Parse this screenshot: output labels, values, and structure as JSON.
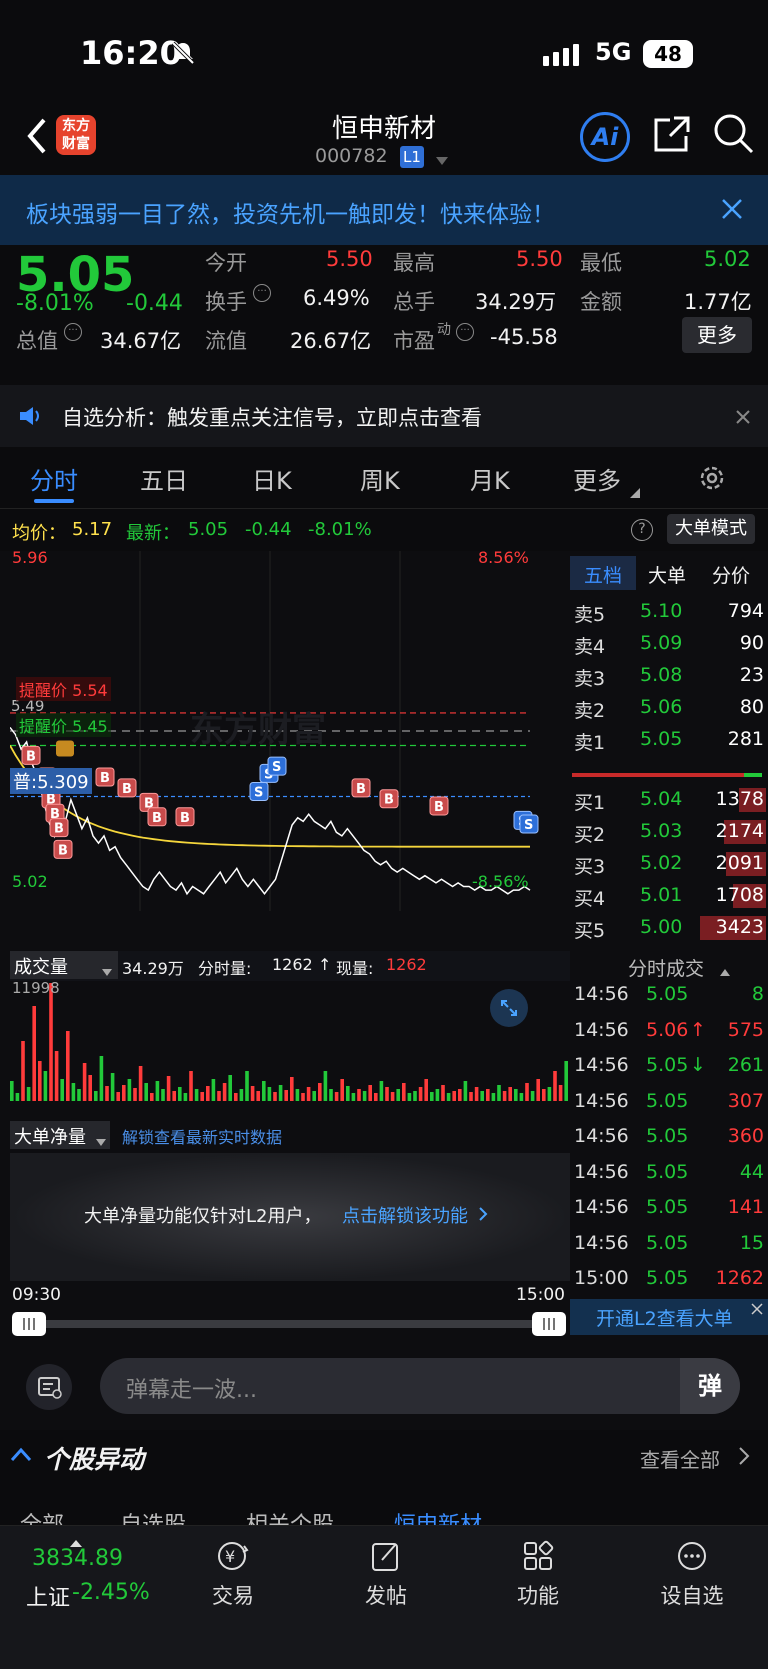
{
  "status_bar": {
    "time": "16:20",
    "network": "5G",
    "battery": "48"
  },
  "header": {
    "stock_name": "恒申新材",
    "stock_code": "000782",
    "level_badge": "L1",
    "logo_text": "东方财富",
    "ai_label": "Ai"
  },
  "banner": {
    "text": "板块强弱一目了然，投资先机一触即发！快来体验！"
  },
  "quote": {
    "price": "5.05",
    "change_pct": "-8.01%",
    "change": "-0.44",
    "open_label": "今开",
    "open": "5.50",
    "high_label": "最高",
    "high": "5.50",
    "low_label": "最低",
    "low": "5.02",
    "turnover_label": "换手",
    "turnover": "6.49%",
    "volume_label": "总手",
    "volume": "34.29万",
    "amount_label": "金额",
    "amount": "1.77亿",
    "mktcap_label": "总值",
    "mktcap": "34.67亿",
    "float_label": "流值",
    "float_cap": "26.67亿",
    "pe_label": "市盈",
    "pe_sup": "动",
    "pe": "-45.58",
    "more_label": "更多"
  },
  "notice": {
    "text": "自选分析：触发重点关注信号，立即点击查看"
  },
  "tabs": [
    "分时",
    "五日",
    "日K",
    "周K",
    "月K",
    "更多"
  ],
  "avg_line": {
    "avg_label": "均价：",
    "avg": "5.17",
    "latest_label": "最新：",
    "latest": "5.05",
    "chg": "-0.44",
    "pct": "-8.01%",
    "mode_label": "大单模式"
  },
  "chart": {
    "price_max": "5.96",
    "pct_max": "8.56%",
    "price_min": "5.02",
    "pct_min": "-8.56%",
    "prev_close": "5.49",
    "alert_high_label": "提醒价 5.54",
    "alert_low_label": "提醒价 5.45",
    "marker_label": "普:5.309",
    "watermark": "东方财富",
    "colors": {
      "price": "#ffffff",
      "avg": "#f5d63c",
      "up": "#ff3b3b",
      "down": "#22c93a",
      "alert_high": "#ff3b3b",
      "alert_low": "#22c93a",
      "marker": "#3a8dff"
    }
  },
  "orderbook": {
    "tabs": [
      "五档",
      "大单",
      "分价"
    ],
    "asks": [
      {
        "label": "卖5",
        "price": "5.10",
        "vol": "794"
      },
      {
        "label": "卖4",
        "price": "5.09",
        "vol": "90"
      },
      {
        "label": "卖3",
        "price": "5.08",
        "vol": "23"
      },
      {
        "label": "卖2",
        "price": "5.06",
        "vol": "80"
      },
      {
        "label": "卖1",
        "price": "5.05",
        "vol": "281"
      }
    ],
    "bids": [
      {
        "label": "买1",
        "price": "5.04",
        "vol": "1378"
      },
      {
        "label": "买2",
        "price": "5.03",
        "vol": "2174"
      },
      {
        "label": "买3",
        "price": "5.02",
        "vol": "2091"
      },
      {
        "label": "买4",
        "price": "5.01",
        "vol": "1708"
      },
      {
        "label": "买5",
        "price": "5.00",
        "vol": "3423"
      }
    ]
  },
  "volume": {
    "selector": "成交量",
    "total": "34.29万",
    "minute_label": "分时量:",
    "minute": "1262",
    "arrow": "↑",
    "now_label": "现量:",
    "now": "1262",
    "axis_max": "11998"
  },
  "bignet": {
    "selector": "大单净量",
    "unlock_link": "解锁查看最新实时数据",
    "message": "大单净量功能仅针对L2用户，",
    "message_link": "点击解锁该功能"
  },
  "trades": {
    "title": "分时成交",
    "rows": [
      {
        "time": "14:56",
        "price": "5.05",
        "flag": "",
        "vol": "8"
      },
      {
        "time": "14:56",
        "price": "5.06",
        "flag": "↑",
        "vol": "575"
      },
      {
        "time": "14:56",
        "price": "5.05",
        "flag": "↓",
        "vol": "261"
      },
      {
        "time": "14:56",
        "price": "5.05",
        "flag": "",
        "vol": "307"
      },
      {
        "time": "14:56",
        "price": "5.05",
        "flag": "",
        "vol": "360"
      },
      {
        "time": "14:56",
        "price": "5.05",
        "flag": "",
        "vol": "44"
      },
      {
        "time": "14:56",
        "price": "5.05",
        "flag": "",
        "vol": "141"
      },
      {
        "time": "14:56",
        "price": "5.05",
        "flag": "",
        "vol": "15"
      },
      {
        "time": "15:00",
        "price": "5.05",
        "flag": "",
        "vol": "1262"
      }
    ],
    "l2_label": "开通L2查看大单"
  },
  "timeaxis": {
    "start": "09:30",
    "end": "15:00"
  },
  "comment": {
    "placeholder": "弹幕走一波...",
    "send": "弹"
  },
  "movers": {
    "title": "个股异动",
    "view_all": "查看全部",
    "subtabs": [
      "全部",
      "自选股",
      "相关个股",
      "恒申新材"
    ]
  },
  "bottombar": {
    "index_value": "3834.89",
    "index_name": "上证",
    "index_pct": "-2.45%",
    "items": [
      "交易",
      "发帖",
      "功能",
      "设自选"
    ]
  }
}
